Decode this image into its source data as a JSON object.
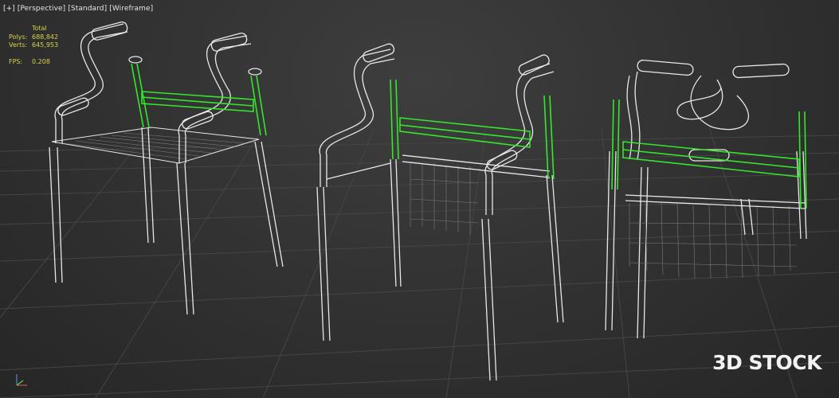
{
  "viewport": {
    "label_plus": "[+]",
    "label_view": "[Perspective]",
    "label_shading": "[Standard]",
    "label_mode": "[Wireframe]"
  },
  "stats": {
    "header": "Total",
    "polys_label": "Polys:",
    "polys_value": "688,842",
    "verts_label": "Verts:",
    "verts_value": "645,953",
    "fps_label": "FPS:",
    "fps_value": "0.208"
  },
  "watermark": "3D STOCK",
  "colors": {
    "wire": "#e8e8e8",
    "selected": "#33e82a",
    "grid": "#474747",
    "stats_text": "#d8d24a"
  },
  "axis_icon": "xyz-axis-tripod-icon"
}
